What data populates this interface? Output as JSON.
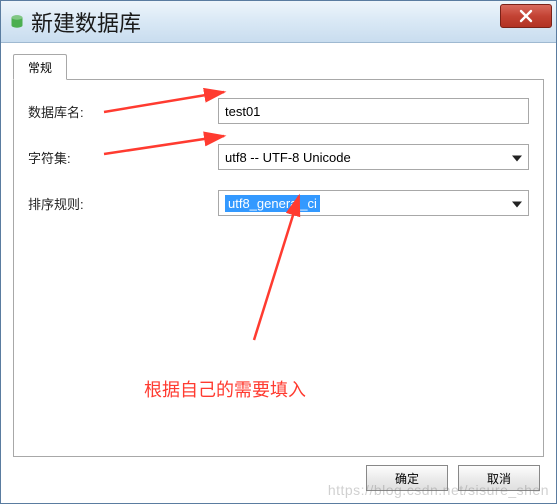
{
  "titlebar": {
    "title": "新建数据库"
  },
  "tab": {
    "general": "常规"
  },
  "form": {
    "db_name_label": "数据库名:",
    "db_name_value": "test01",
    "charset_label": "字符集:",
    "charset_value": "utf8 -- UTF-8 Unicode",
    "collation_label": "排序规则:",
    "collation_value": "utf8_general_ci"
  },
  "buttons": {
    "ok": "确定",
    "cancel": "取消"
  },
  "annotation": {
    "note": "根据自己的需要填入"
  },
  "watermark": "https://blog.csdn.net/sisure_shen"
}
